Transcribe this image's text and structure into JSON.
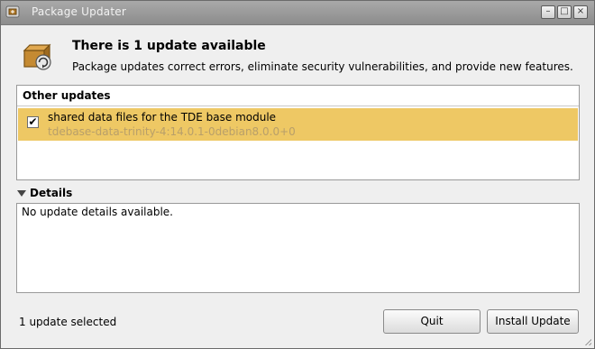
{
  "window": {
    "title": "Package Updater",
    "controls": {
      "minimize": "–",
      "maximize": "□",
      "close": "×"
    },
    "icon": "package-updater-icon"
  },
  "header": {
    "icon": "package-box-icon",
    "title": "There is 1 update available",
    "description": "Package updates correct errors, eliminate security vulnerabilities, and provide new features."
  },
  "updates": {
    "group_label": "Other updates",
    "items": [
      {
        "checked": true,
        "check_mark": "✔",
        "summary": "shared data files for the TDE base module",
        "package": "tdebase-data-trinity-4:14.0.1-0debian8.0.0+0"
      }
    ],
    "selected_row_color": "#eec864"
  },
  "details": {
    "label": "Details",
    "text": "No update details available."
  },
  "footer": {
    "status": "1 update selected",
    "quit_label": "Quit",
    "install_label": "Install Update"
  }
}
